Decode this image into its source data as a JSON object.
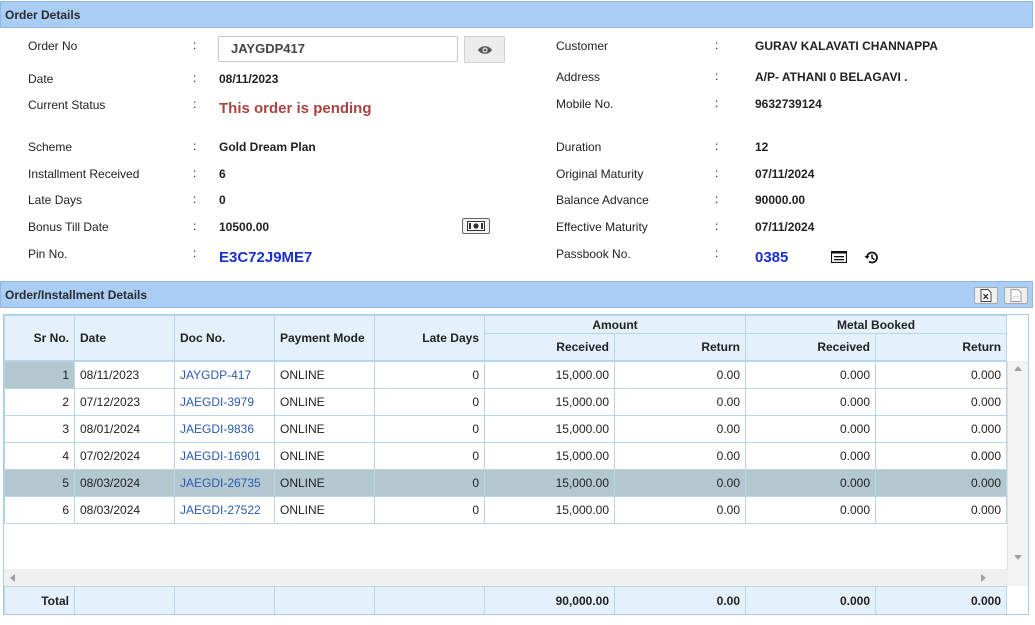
{
  "order_details": {
    "header": "Order Details",
    "left": [
      {
        "label": "Order No",
        "value": "JAYGDP417"
      },
      {
        "label": "Date",
        "value": "08/11/2023"
      },
      {
        "label": "Current Status",
        "value": "This order is pending"
      },
      {
        "label": "Scheme",
        "value": "Gold Dream Plan"
      },
      {
        "label": "Installment Received",
        "value": "6"
      },
      {
        "label": "Late Days",
        "value": "0"
      },
      {
        "label": "Bonus Till Date",
        "value": "10500.00"
      },
      {
        "label": "Pin No.",
        "value": "E3C72J9ME7"
      }
    ],
    "right": [
      {
        "label": "Customer",
        "value": "GURAV KALAVATI CHANNAPPA"
      },
      {
        "label": "Address",
        "value": "A/P- ATHANI 0 BELAGAVI ."
      },
      {
        "label": "Mobile No.",
        "value": "9632739124"
      },
      {
        "label": "Duration",
        "value": "12"
      },
      {
        "label": "Original Maturity",
        "value": "07/11/2024"
      },
      {
        "label": "Balance Advance",
        "value": "90000.00"
      },
      {
        "label": "Effective Maturity",
        "value": "07/11/2024"
      },
      {
        "label": "Passbook No.",
        "value": "0385"
      }
    ],
    "colon": ":"
  },
  "installments": {
    "header": "Order/Installment Details",
    "columns": {
      "sr_no": "Sr No.",
      "date": "Date",
      "doc_no": "Doc No.",
      "payment_mode": "Payment Mode",
      "late_days": "Late Days",
      "amount": "Amount",
      "metal_booked": "Metal Booked",
      "received": "Received",
      "return": "Return"
    },
    "rows": [
      {
        "sr": "1",
        "date": "08/11/2023",
        "doc": "JAYGDP-417",
        "mode": "ONLINE",
        "late": "0",
        "amt_recv": "15,000.00",
        "amt_ret": "0.00",
        "metal_recv": "0.000",
        "metal_ret": "0.000"
      },
      {
        "sr": "2",
        "date": "07/12/2023",
        "doc": "JAEGDI-3979",
        "mode": "ONLINE",
        "late": "0",
        "amt_recv": "15,000.00",
        "amt_ret": "0.00",
        "metal_recv": "0.000",
        "metal_ret": "0.000"
      },
      {
        "sr": "3",
        "date": "08/01/2024",
        "doc": "JAEGDI-9836",
        "mode": "ONLINE",
        "late": "0",
        "amt_recv": "15,000.00",
        "amt_ret": "0.00",
        "metal_recv": "0.000",
        "metal_ret": "0.000"
      },
      {
        "sr": "4",
        "date": "07/02/2024",
        "doc": "JAEGDI-16901",
        "mode": "ONLINE",
        "late": "0",
        "amt_recv": "15,000.00",
        "amt_ret": "0.00",
        "metal_recv": "0.000",
        "metal_ret": "0.000"
      },
      {
        "sr": "5",
        "date": "08/03/2024",
        "doc": "JAEGDI-26735",
        "mode": "ONLINE",
        "late": "0",
        "amt_recv": "15,000.00",
        "amt_ret": "0.00",
        "metal_recv": "0.000",
        "metal_ret": "0.000"
      },
      {
        "sr": "6",
        "date": "08/03/2024",
        "doc": "JAEGDI-27522",
        "mode": "ONLINE",
        "late": "0",
        "amt_recv": "15,000.00",
        "amt_ret": "0.00",
        "metal_recv": "0.000",
        "metal_ret": "0.000"
      }
    ],
    "total": {
      "label": "Total",
      "amt_recv": "90,000.00",
      "amt_ret": "0.00",
      "metal_recv": "0.000",
      "metal_ret": "0.000"
    }
  },
  "colors": {
    "status_red": "#a94442",
    "link_blue": "#1a2fd1",
    "header_bg": "#a9cdf5",
    "selected_row": "#b3c7cf"
  },
  "icons": {
    "view": "eye-icon",
    "cash": "cash-icon",
    "passbook": "list-icon",
    "history": "history-icon",
    "excel": "excel-icon",
    "pdf": "pdf-icon"
  }
}
